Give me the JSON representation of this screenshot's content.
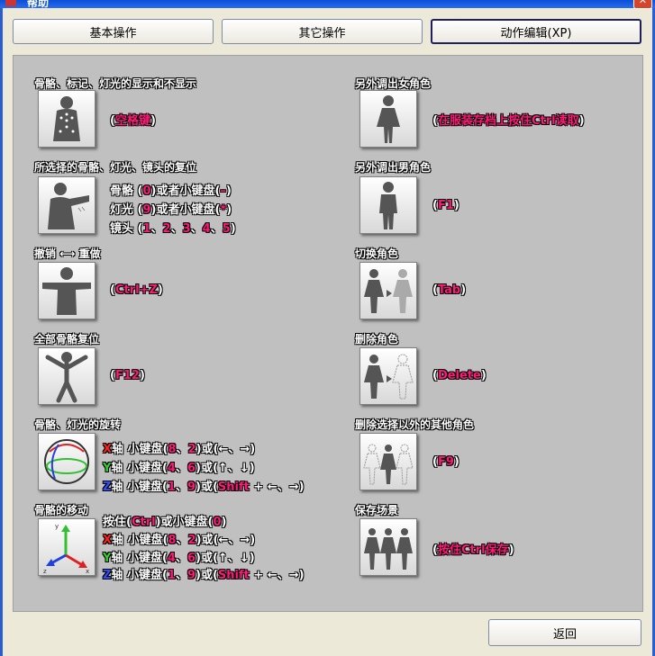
{
  "window": {
    "title": "帮助",
    "close_glyph": "✕"
  },
  "tabs": [
    {
      "label": "基本操作"
    },
    {
      "label": "其它操作"
    },
    {
      "label": "动作编辑(XP)"
    }
  ],
  "return_label": "返回",
  "left": {
    "s1": {
      "title": "骨骼、标记、灯光的显示和不显示",
      "l1_o": "(",
      "l1_k": "空格键",
      "l1_c": ")"
    },
    "s2": {
      "title": "所选择的骨骼、灯光、镜头的复位",
      "r1": {
        "label": "骨骼 (",
        "k1": "0",
        "mid": ")或者小键盘(",
        "k2": "–",
        "end": ")"
      },
      "r2": {
        "label": "灯光 (",
        "k1": "9",
        "mid": ")或者小键盘(",
        "k2": "*",
        "end": ")"
      },
      "r3": {
        "label": "镜头 (",
        "k1": "1",
        "s1": "、",
        "k2": "2",
        "s2": "、",
        "k3": "3",
        "s3": "、",
        "k4": "4",
        "s4": "、",
        "k5": "5",
        "end": ")"
      }
    },
    "s3": {
      "t1": "撤销",
      "arrow": "⟷",
      "t2": "重做",
      "o": "(",
      "k": "Ctrl+Z",
      "c": ")"
    },
    "s4": {
      "title": "全部骨骼复位",
      "o": "(",
      "k": "F12",
      "c": ")"
    },
    "s5": {
      "title": "骨骼、灯光的旋转",
      "x": {
        "ax": "X",
        "t": "轴 小键盘(",
        "k1": "8",
        "s": "、",
        "k2": "2",
        "m": ")或(",
        "k3": "←、→",
        "e": ")"
      },
      "y": {
        "ax": "Y",
        "t": "轴 小键盘(",
        "k1": "4",
        "s": "、",
        "k2": "6",
        "m": ")或(",
        "k3": "↑、↓",
        "e": ")"
      },
      "z": {
        "ax": "Z",
        "t": "轴 小键盘(",
        "k1": "1",
        "s": "、",
        "k2": "9",
        "m": ")或(",
        "k3": "Shift",
        "plus": " + ←、→",
        "e": ")"
      }
    },
    "s6": {
      "title": "骨骼的移动",
      "p": {
        "t": "按住(",
        "k1": "Ctrl",
        "m": ")或小键盘(",
        "k2": "0",
        "e": ")"
      },
      "x": {
        "ax": "X",
        "t": "轴 小键盘(",
        "k1": "8",
        "s": "、",
        "k2": "2",
        "m": ")或(",
        "k3": "←、→",
        "e": ")"
      },
      "y": {
        "ax": "Y",
        "t": "轴 小键盘(",
        "k1": "4",
        "s": "、",
        "k2": "6",
        "m": ")或(",
        "k3": "↑、↓",
        "e": ")"
      },
      "z": {
        "ax": "Z",
        "t": "轴 小键盘(",
        "k1": "1",
        "s": "、",
        "k2": "9",
        "m": ")或(",
        "k3": "Shift",
        "plus": " + ←、→",
        "e": ")"
      },
      "axis_labels": {
        "y": "y",
        "z": "z",
        "x": "x"
      }
    }
  },
  "right": {
    "s1": {
      "title": "另外调出女角色",
      "o": "(",
      "k": "在服装存档上按住Ctrl读取",
      "c": ")"
    },
    "s2": {
      "title": "另外调出男角色",
      "o": "(",
      "k": "F1",
      "c": ")"
    },
    "s3": {
      "title": "切换角色",
      "o": "(",
      "k": "Tab",
      "c": ")"
    },
    "s4": {
      "title": "删除角色",
      "o": "(",
      "k": "Delete",
      "c": ")"
    },
    "s5": {
      "title": "删除选择以外的其他角色",
      "o": "(",
      "k": "F9",
      "c": ")"
    },
    "s6": {
      "title": "保存场景",
      "o": "(",
      "k": "按住Ctrl保存",
      "c": ")"
    }
  },
  "colors": {
    "key": "#ff1a7a",
    "axis_x": "#ff2020",
    "axis_y": "#30d030",
    "axis_z": "#3050ff",
    "panel": "#c0c0c0"
  }
}
